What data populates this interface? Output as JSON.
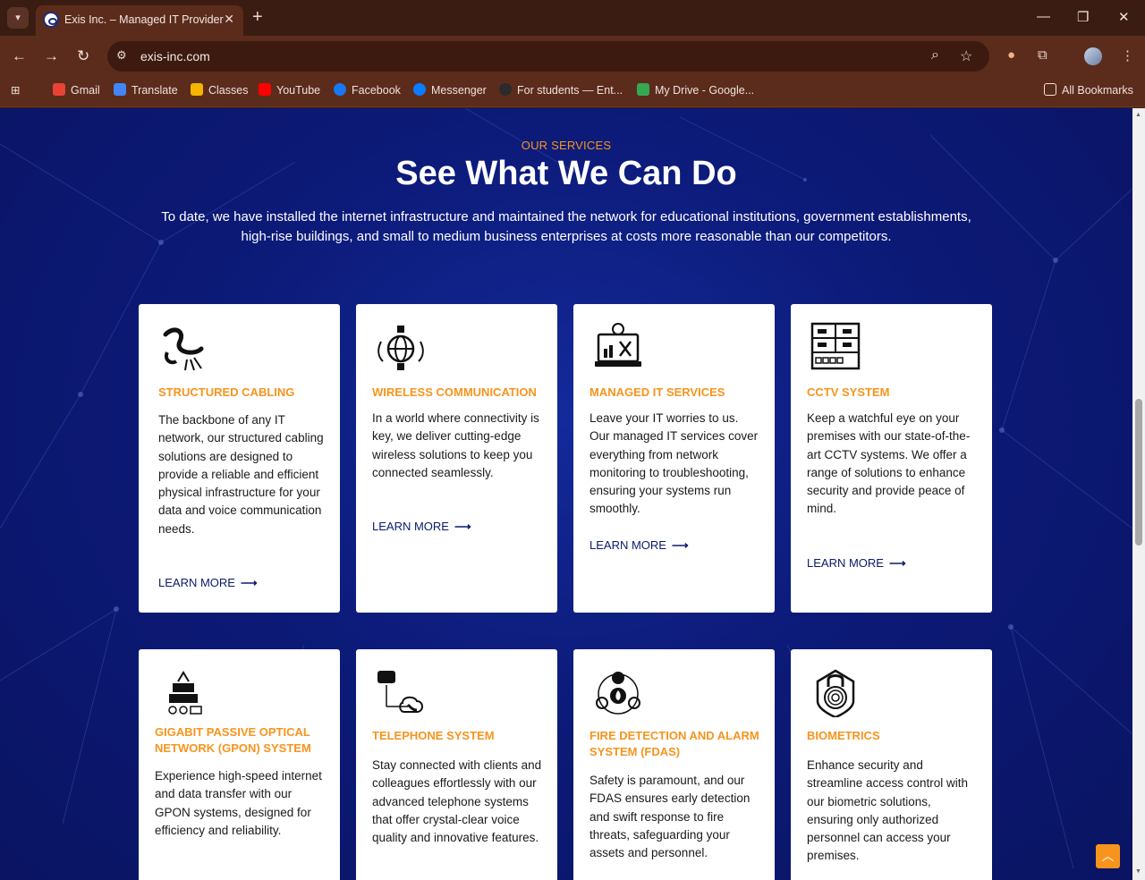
{
  "browser": {
    "tab_title": "Exis Inc. – Managed IT Provider",
    "url": "exis-inc.com",
    "bookmarks": [
      {
        "label": "Gmail",
        "color": "#ea4335"
      },
      {
        "label": "Translate",
        "color": "#4285f4"
      },
      {
        "label": "Classes",
        "color": "#f4b400"
      },
      {
        "label": "YouTube",
        "color": "#ff0000"
      },
      {
        "label": "Facebook",
        "color": "#1877f2"
      },
      {
        "label": "Messenger",
        "color": "#0a7cff"
      },
      {
        "label": "For students — Ent...",
        "color": "#2b2b2b"
      },
      {
        "label": "My Drive - Google...",
        "color": "#34a853"
      }
    ],
    "all_bookmarks": "All Bookmarks"
  },
  "section": {
    "eyebrow": "OUR SERVICES",
    "headline": "See What We Can Do",
    "intro": "To date, we have installed the internet infrastructure and maintained the network for educational institutions, government establishments, high-rise buildings, and small to medium business enterprises at costs more reasonable than our competitors."
  },
  "learn_more": "LEARN MORE",
  "arrow": "⟶",
  "services": [
    {
      "title": "STRUCTURED CABLING",
      "text": "The backbone of any IT network, our structured cabling solutions are designed to provide a reliable and efficient physical infrastructure for your data and voice communication needs.",
      "icon": "cable-icon"
    },
    {
      "title": "WIRELESS COMMUNICATION",
      "text": "In a world where connectivity is key, we deliver cutting-edge wireless solutions to keep you connected seamlessly.",
      "icon": "wireless-globe-icon"
    },
    {
      "title": "MANAGED IT SERVICES",
      "text": "Leave your IT worries to us. Our managed IT services cover everything from network monitoring to troubleshooting, ensuring your systems run smoothly.",
      "icon": "laptop-gear-icon"
    },
    {
      "title": "CCTV SYSTEM",
      "text": "Keep a watchful eye on your premises with our state-of-the-art CCTV systems. We offer a range of solutions to enhance security and provide peace of mind.",
      "icon": "cctv-icon"
    },
    {
      "title": "GIGABIT PASSIVE OPTICAL NETWORK (GPON) SYSTEM",
      "text": "Experience high-speed internet and data transfer with our GPON systems, designed for efficiency and reliability.",
      "icon": "gpon-icon"
    },
    {
      "title": "TELEPHONE SYSTEM",
      "text": "Stay connected with clients and colleagues effortlessly with our advanced telephone systems that offer crystal-clear voice quality and innovative features.",
      "icon": "telephone-icon"
    },
    {
      "title": "FIRE DETECTION AND ALARM SYSTEM (FDAS)",
      "text": "Safety is paramount, and our FDAS ensures early detection and swift response to fire threats, safeguarding your assets and personnel.",
      "icon": "fire-alarm-icon"
    },
    {
      "title": "BIOMETRICS",
      "text": "Enhance security and streamline access control with our biometric solutions, ensuring only authorized personnel can access your premises.",
      "icon": "fingerprint-lock-icon"
    }
  ]
}
